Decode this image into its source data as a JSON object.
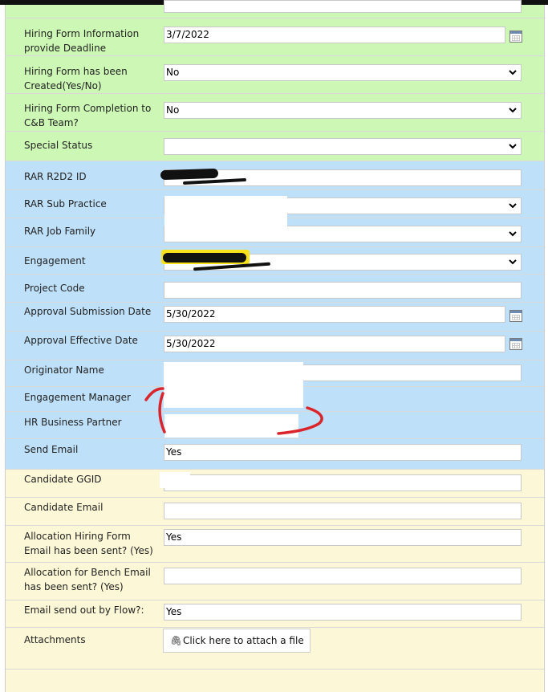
{
  "fields": {
    "deadline": {
      "label": "Hiring Form Information provide Deadline",
      "value": "3/7/2022"
    },
    "created": {
      "label": "Hiring Form has been Created(Yes/No)",
      "value": "No"
    },
    "completion": {
      "label": "Hiring Form Completion to C&B Team?",
      "value": "No"
    },
    "special_status": {
      "label": "Special Status",
      "value": ""
    },
    "rar_id": {
      "label": "RAR R2D2 ID",
      "value": ""
    },
    "sub_practice": {
      "label": "RAR Sub Practice",
      "value": ""
    },
    "job_family": {
      "label": "RAR Job Family",
      "value": ""
    },
    "engagement": {
      "label": "Engagement",
      "value": ""
    },
    "project_code": {
      "label": "Project Code",
      "value": ""
    },
    "approval_submission": {
      "label": "Approval Submission Date",
      "value": "5/30/2022"
    },
    "approval_effective": {
      "label": "Approval Effective Date",
      "value": "5/30/2022"
    },
    "originator": {
      "label": "Originator Name",
      "value": ""
    },
    "engagement_manager": {
      "label": "Engagement Manager",
      "value": ""
    },
    "hr_partner": {
      "label": "HR Business Partner",
      "value": ""
    },
    "send_email": {
      "label": "Send Email",
      "value": "Yes"
    },
    "candidate_ggid": {
      "label": "Candidate GGID",
      "value": ""
    },
    "candidate_email": {
      "label": "Candidate Email",
      "value": ""
    },
    "allocation_hiring": {
      "label": "Allocation Hiring Form Email has been sent? (Yes)",
      "value": "Yes"
    },
    "allocation_bench": {
      "label": "Allocation for Bench Email has been sent? (Yes)",
      "value": ""
    },
    "flow": {
      "label": "Email send out by Flow?:",
      "value": "Yes"
    },
    "attachments": {
      "label": "Attachments",
      "button": "Click here to attach a file"
    }
  },
  "colors": {
    "green": "#ccf7b4",
    "blue": "#bee0f8",
    "cream": "#fcf7d6",
    "annotation_red": "#d9252b",
    "highlight_yellow": "#f7e21b"
  },
  "icons": {
    "dropdown": "chevron-down-icon",
    "calendar": "calendar-icon",
    "attach": "paperclip-icon"
  }
}
